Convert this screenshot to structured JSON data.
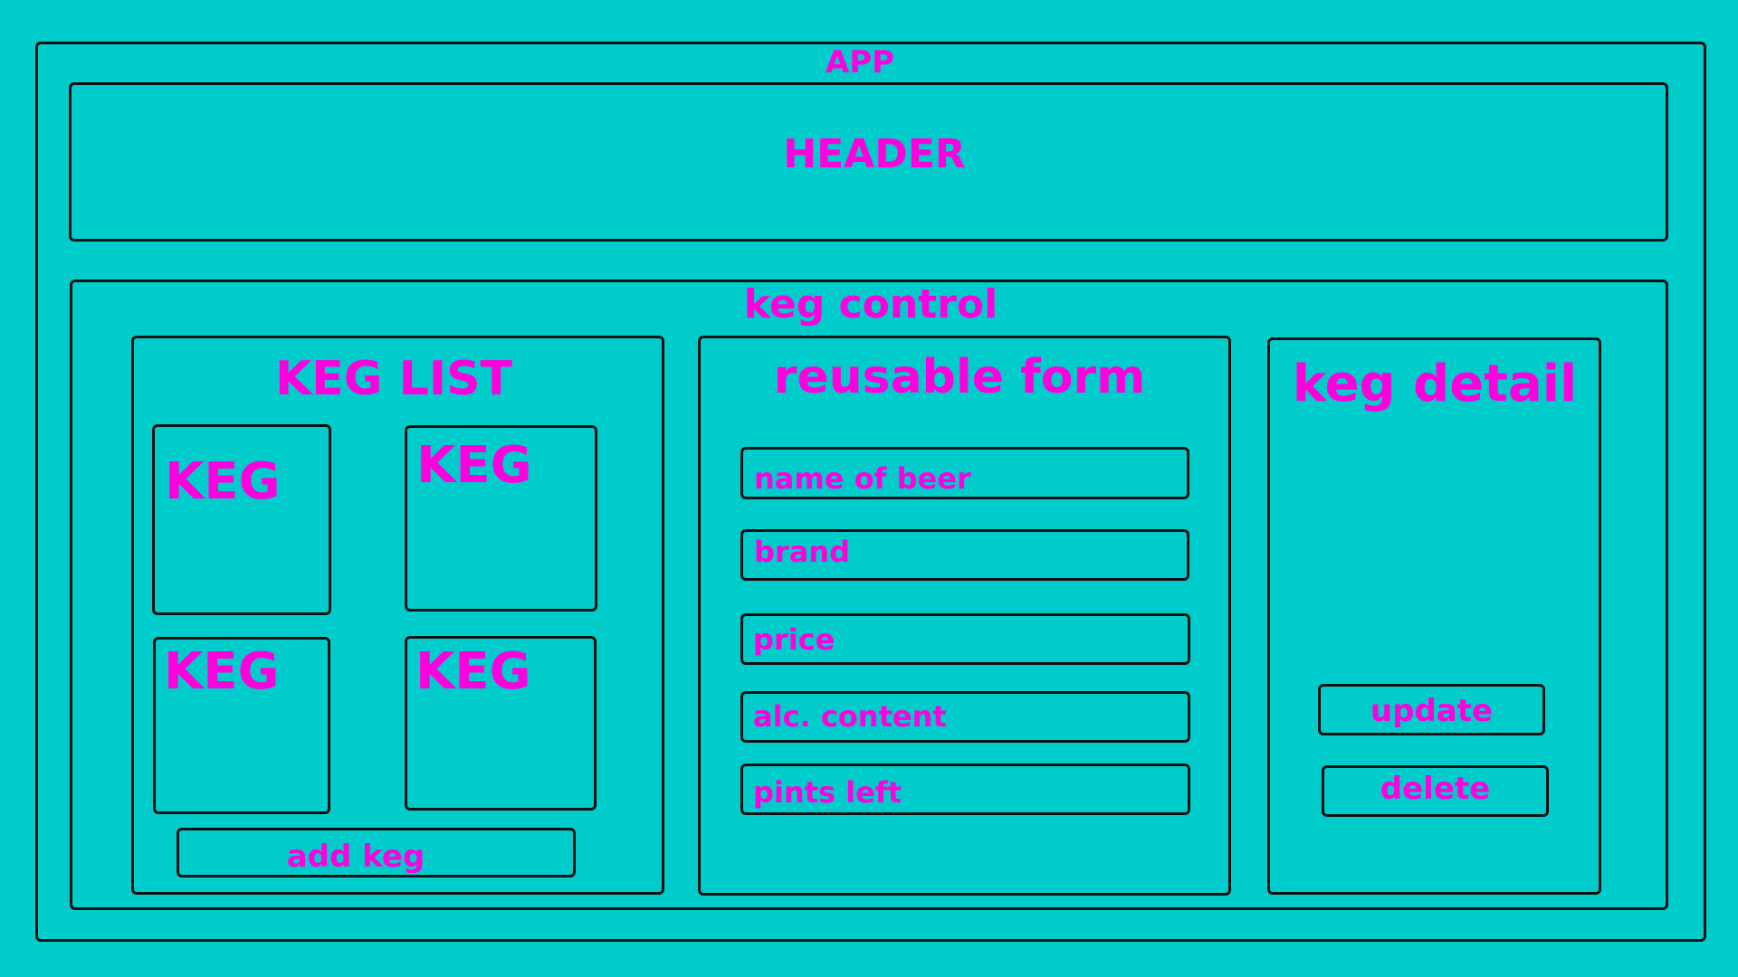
{
  "colors": {
    "background": "#00cccc",
    "label": "#ff00dd",
    "outline": "#111111"
  },
  "app": {
    "title": "APP",
    "header": {
      "title": "HEADER"
    },
    "keg_control": {
      "title": "keg control",
      "keg_list": {
        "title": "KEG LIST",
        "kegs": [
          "KEG",
          "KEG",
          "KEG",
          "KEG"
        ],
        "add_button": "add keg"
      },
      "reusable_form": {
        "title": "reusable form",
        "fields": [
          "name of beer",
          "brand",
          "price",
          "alc. content",
          "pints left"
        ]
      },
      "keg_detail": {
        "title": "keg detail",
        "update_button": "update",
        "delete_button": "delete"
      }
    }
  }
}
